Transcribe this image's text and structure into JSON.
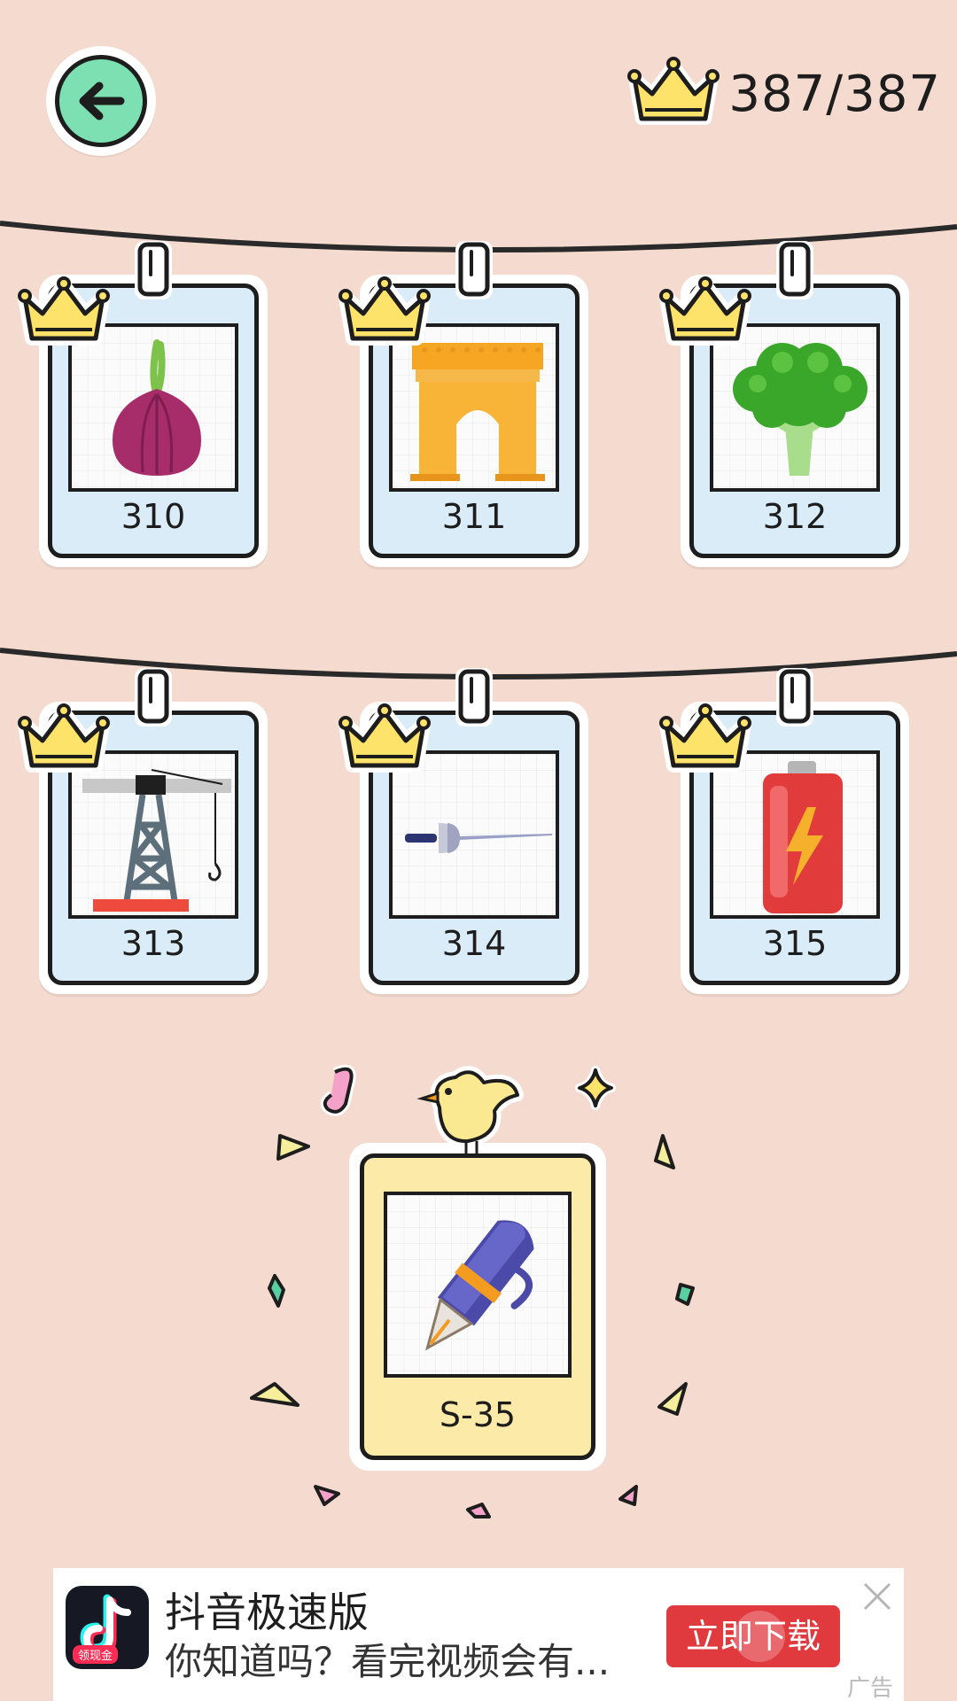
{
  "header": {
    "back_icon": "arrow-left-icon",
    "crown_icon": "crown-icon",
    "crown_count": "387/387"
  },
  "cards": [
    {
      "number": "310",
      "item": "onion",
      "completed": true
    },
    {
      "number": "311",
      "item": "arch",
      "completed": true
    },
    {
      "number": "312",
      "item": "broccoli",
      "completed": true
    },
    {
      "number": "313",
      "item": "crane-tower",
      "completed": true
    },
    {
      "number": "314",
      "item": "fencing-sword",
      "completed": true
    },
    {
      "number": "315",
      "item": "battery",
      "completed": true
    }
  ],
  "featured": {
    "number": "S-35",
    "item": "fountain-pen"
  },
  "ad": {
    "app_name": "抖音极速版",
    "description": "你知道吗？看完视频会有...",
    "cta_label": "立即下载",
    "icon_tag": "领现金",
    "ad_label": "广告"
  },
  "colors": {
    "background": "#f5dbcf",
    "card_paper": "#d9ecf7",
    "featured_paper": "#fbeaa8",
    "back_button": "#7de0b2",
    "crown": "#fde36a",
    "cta": "#e0393e"
  }
}
